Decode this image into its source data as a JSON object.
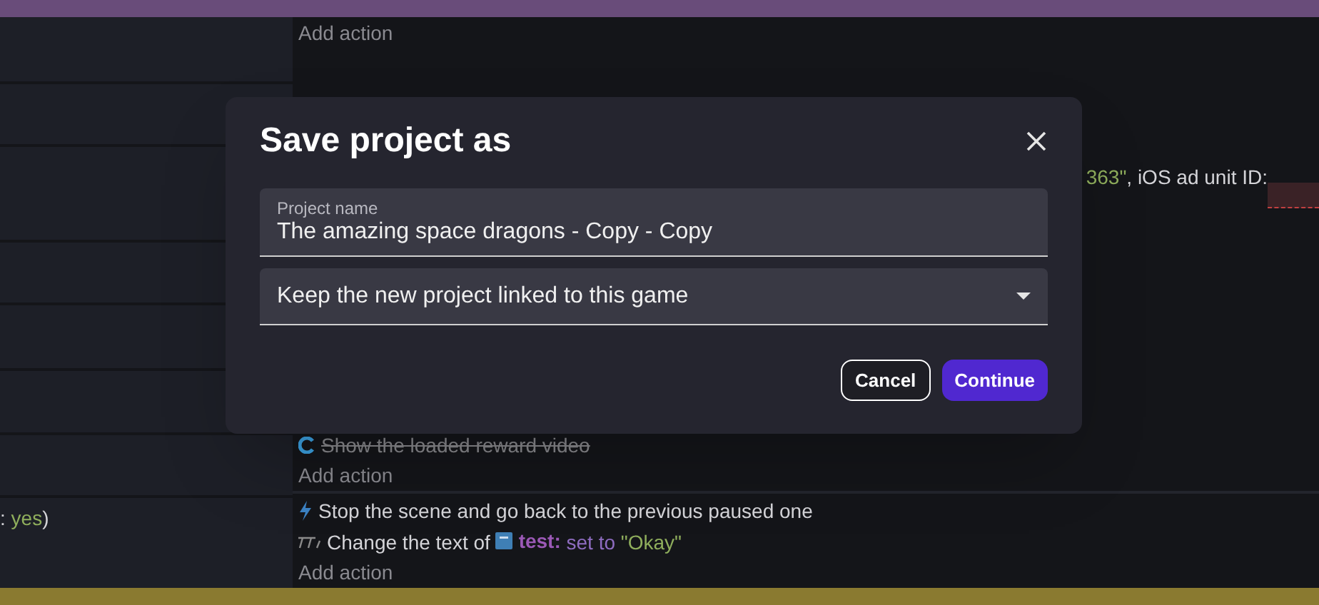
{
  "event_sheet": {
    "top_action": {
      "text": "Add action"
    },
    "param_fragment": [
      {
        "kind": "string",
        "text": "363\""
      },
      {
        "kind": "plain",
        "text": ", iOS ad unit ID:"
      }
    ],
    "condition_fragment": [
      {
        "kind": "plain",
        "text": ": "
      },
      {
        "kind": "value",
        "text": "yes"
      },
      {
        "kind": "plain",
        "text": ")"
      }
    ],
    "event_a": [
      {
        "kind": "reward",
        "disabled": true,
        "text": "Show the loaded reward video"
      },
      {
        "kind": "add",
        "text": "Add action"
      }
    ],
    "event_b": [
      {
        "kind": "scene",
        "disabled": false,
        "text": "Stop the scene and go back to the previous paused one"
      },
      {
        "kind": "text",
        "disabled": false,
        "parts": [
          {
            "kind": "plain",
            "text": "Change the text of "
          },
          {
            "kind": "object",
            "text": "test:"
          },
          {
            "kind": "operator",
            "text": " set to "
          },
          {
            "kind": "string",
            "text": "\"Okay\""
          }
        ]
      },
      {
        "kind": "add",
        "text": "Add action"
      }
    ]
  },
  "dialog": {
    "title": "Save project as",
    "name_field": {
      "label": "Project name",
      "value": "The amazing space dragons - Copy - Copy"
    },
    "link_select": {
      "value": "Keep the new project linked to this game"
    },
    "buttons": [
      {
        "kind": "secondary",
        "label": "Cancel"
      },
      {
        "kind": "primary",
        "label": "Continue"
      }
    ]
  }
}
